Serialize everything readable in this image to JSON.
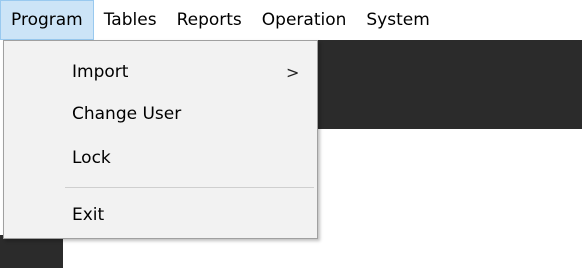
{
  "menubar": {
    "items": [
      {
        "label": "Program",
        "active": true
      },
      {
        "label": "Tables",
        "active": false
      },
      {
        "label": "Reports",
        "active": false
      },
      {
        "label": "Operation",
        "active": false
      },
      {
        "label": "System",
        "active": false
      }
    ]
  },
  "program_menu": {
    "items": [
      {
        "label": "Import",
        "has_submenu": true,
        "icon": "chevron-right-icon"
      },
      {
        "label": "Change User",
        "has_submenu": false
      },
      {
        "label": "Lock",
        "has_submenu": false
      },
      {
        "label": "Exit",
        "has_submenu": false
      }
    ],
    "submenu_glyph": ">"
  },
  "colors": {
    "active_menu_bg": "#cce4f7",
    "active_menu_border": "#99c9ef",
    "dropdown_bg": "#f2f2f2",
    "dark_background": "#2b2b2b"
  }
}
